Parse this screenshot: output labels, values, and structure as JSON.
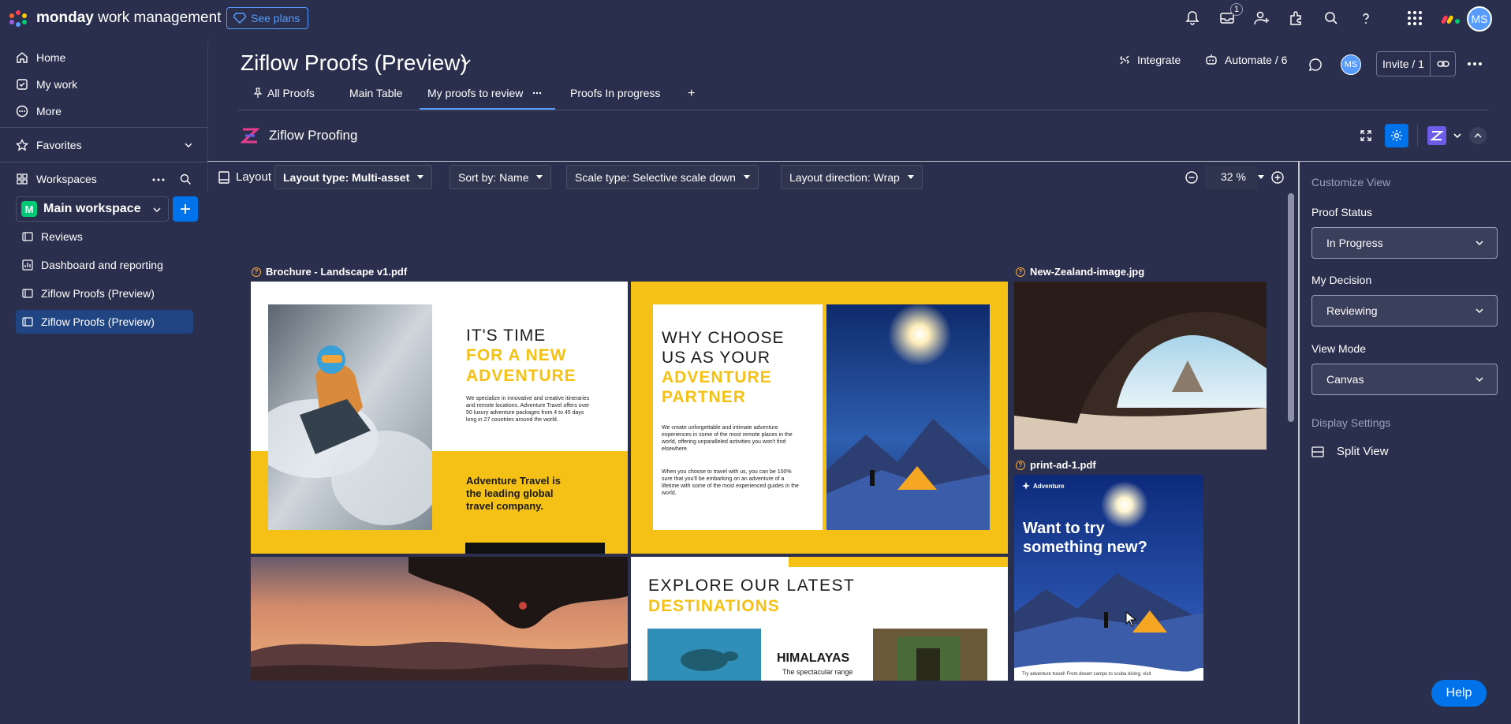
{
  "topbar": {
    "brand_bold": "monday",
    "brand_rest": " work management",
    "see_plans": "See plans",
    "notification_badge": "1",
    "avatar_initials": "MS",
    "icons": [
      "bell-icon",
      "inbox-icon",
      "invite-user-icon",
      "apps-icon",
      "search-icon",
      "help-icon",
      "grid-icon"
    ]
  },
  "sidebar": {
    "nav": [
      {
        "label": "Home",
        "icon": "home-icon"
      },
      {
        "label": "My work",
        "icon": "checklist-icon"
      },
      {
        "label": "More",
        "icon": "more-circle-icon"
      }
    ],
    "favorites": "Favorites",
    "workspaces": "Workspaces",
    "workspace": {
      "badge": "M",
      "name": "Main workspace"
    },
    "boards": [
      {
        "label": "Reviews",
        "icon": "board-icon"
      },
      {
        "label": "Dashboard and reporting",
        "icon": "dashboard-icon"
      },
      {
        "label": "Ziflow Proofs (Preview)",
        "icon": "board-icon"
      },
      {
        "label": "Ziflow Proofs (Preview)",
        "icon": "board-icon",
        "active": true
      }
    ]
  },
  "board": {
    "title": "Ziflow Proofs (Preview)",
    "integrate": "Integrate",
    "automate": "Automate / 6",
    "avatar_initials": "MS",
    "invite": "Invite / 1",
    "tabs": [
      {
        "label": "All Proofs",
        "pinned": true
      },
      {
        "label": "Main Table"
      },
      {
        "label": "My proofs to review",
        "active": true
      },
      {
        "label": "Proofs In progress"
      }
    ],
    "add_tab": "+"
  },
  "app": {
    "name": "Ziflow Proofing"
  },
  "toolbar": {
    "layout": "Layout",
    "layout_type": "Layout type: Multi-asset",
    "sort_by": "Sort by: Name",
    "scale_type": "Scale type: Selective scale down",
    "layout_direction": "Layout direction: Wrap",
    "zoom": "32 %"
  },
  "assets": [
    {
      "name": "Brochure - Landscape v1.pdf"
    },
    {
      "name": "New-Zealand-image.jpg"
    },
    {
      "name": "print-ad-1.pdf"
    }
  ],
  "brochure": {
    "p1_title_a": "IT'S TIME",
    "p1_title_b": "FOR A NEW",
    "p1_title_c": "ADVENTURE",
    "p1_body": "We specialize in innovative and creative itineraries and remote locations. Adventure Travel offers over 50 luxury adventure packages from 4 to 45 days long in 27 countries around the world.",
    "p1_tagline": "Adventure Travel is the leading global travel company.",
    "p2_title_a": "WHY CHOOSE",
    "p2_title_b": "US AS YOUR",
    "p2_title_c": "ADVENTURE",
    "p2_title_d": "PARTNER",
    "p2_body_1": "We create unforgettable and intimate adventure experiences in some of the most remote places in the world, offering unparalleled activities you won't find elsewhere.",
    "p2_body_2": "When you choose to travel with us, you can be 100% sure that you'll be embarking on an adventure of a lifetime with some of the most experienced guides in the world.",
    "p4_title_a": "EXPLORE OUR LATEST",
    "p4_title_b": "DESTINATIONS",
    "p4_dest": "HIMALAYAS",
    "p4_dest_sub": "The spectacular range"
  },
  "print_ad": {
    "brand": "Adventure",
    "headline": "Want to try something new?",
    "footer": "Try adventure travel! From desert camps to scuba diving, visit"
  },
  "panel": {
    "title": "Customize View",
    "proof_status_label": "Proof Status",
    "proof_status": "In Progress",
    "my_decision_label": "My Decision",
    "my_decision": "Reviewing",
    "view_mode_label": "View Mode",
    "view_mode": "Canvas",
    "display_settings": "Display Settings",
    "split_view": "Split View"
  },
  "help": "Help",
  "colors": {
    "accent": "#0073ea",
    "bg": "#292f4c",
    "yellow": "#f5c116",
    "orange": "#fdab3d"
  }
}
